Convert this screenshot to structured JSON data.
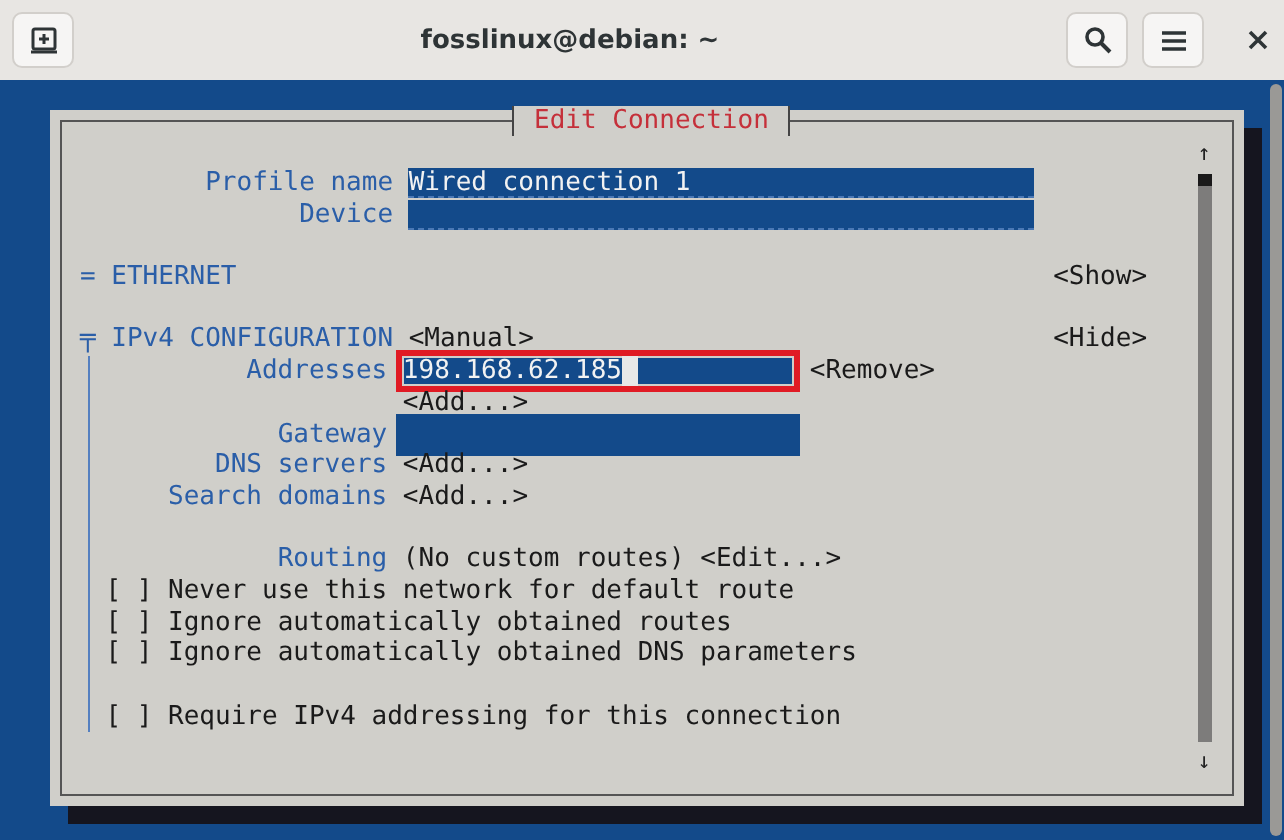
{
  "window": {
    "title": "fosslinux@debian: ~"
  },
  "dialog": {
    "title": "Edit Connection",
    "scroll_up": "↑",
    "scroll_down": "↓"
  },
  "profile": [
    {
      "label": "Profile name",
      "value": "Wired connection 1"
    },
    {
      "label": "Device"
    }
  ],
  "ethernet": {
    "marker": "=",
    "title": "ETHERNET",
    "toggle": "<Show>"
  },
  "ipv4": {
    "marker": "╤",
    "title": "IPv4 CONFIGURATION",
    "mode": "<Manual>",
    "toggle": "<Hide>",
    "rows": [
      {
        "kind": "field",
        "label": "Addresses",
        "value": "198.168.62.185",
        "highlighted": true,
        "cursor": true,
        "action": "<Remove>"
      },
      {
        "kind": "button",
        "action": "<Add...>"
      },
      {
        "kind": "field",
        "label": "Gateway",
        "highlighted": false
      },
      {
        "kind": "button",
        "label": "DNS servers",
        "action": "<Add...>"
      },
      {
        "kind": "button",
        "label": "Search domains",
        "action": "<Add...>"
      }
    ],
    "routing": {
      "label": "Routing",
      "value": "(No custom routes)",
      "action": "<Edit...>"
    },
    "options": [
      {
        "box": "[ ]",
        "checked": false,
        "label": "Never use this network for default route"
      },
      {
        "box": "[ ]",
        "checked": false,
        "label": "Ignore automatically obtained routes"
      },
      {
        "box": "[ ]",
        "checked": false,
        "label": "Ignore automatically obtained DNS parameters"
      }
    ],
    "require": {
      "box": "[ ]",
      "checked": false,
      "label": "Require IPv4 addressing for this connection"
    }
  }
}
